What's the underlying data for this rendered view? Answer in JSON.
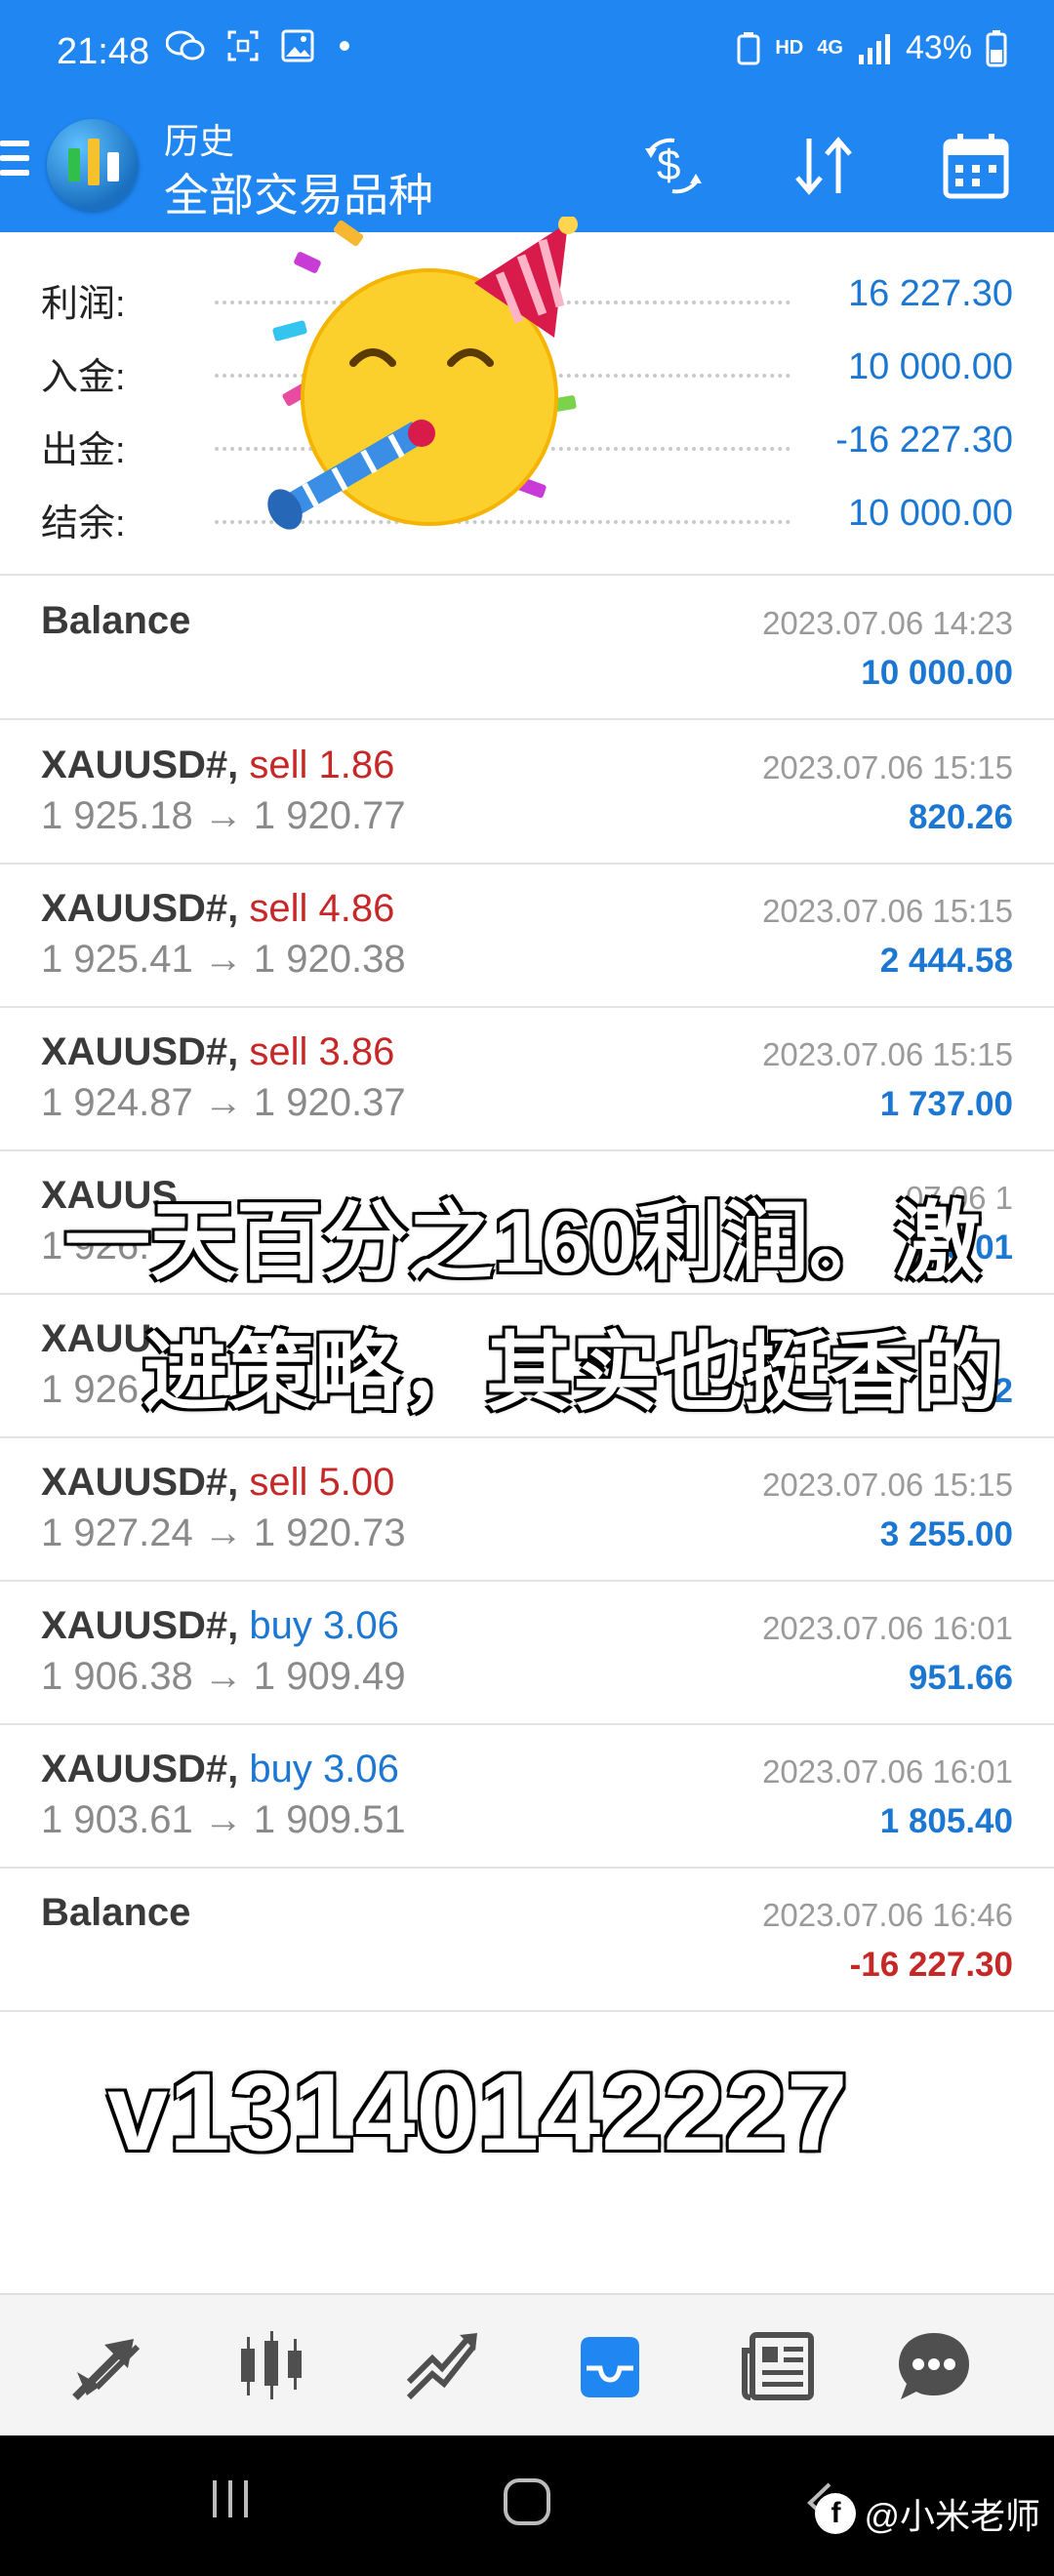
{
  "status_bar": {
    "time": "21:48",
    "network": "HD",
    "signal": "4G",
    "battery": "43%"
  },
  "app_bar": {
    "title": "历史",
    "subtitle": "全部交易品种"
  },
  "summary": [
    {
      "label": "利润:",
      "value": "16 227.30"
    },
    {
      "label": "入金:",
      "value": "10 000.00"
    },
    {
      "label": "出金:",
      "value": "-16 227.30"
    },
    {
      "label": "结余:",
      "value": "10 000.00"
    }
  ],
  "history": [
    {
      "type": "balance",
      "title": "Balance",
      "date": "2023.07.06 14:23",
      "profit": "10 000.00",
      "negative": false
    },
    {
      "type": "trade",
      "symbol": "XAUUSD#,",
      "direction": "sell",
      "volume": "sell 1.86",
      "prices": "1 925.18 → 1 920.77",
      "date": "2023.07.06 15:15",
      "profit": "820.26"
    },
    {
      "type": "trade",
      "symbol": "XAUUSD#,",
      "direction": "sell",
      "volume": "sell 4.86",
      "prices": "1 925.41 → 1 920.38",
      "date": "2023.07.06 15:15",
      "profit": "2 444.58"
    },
    {
      "type": "trade",
      "symbol": "XAUUSD#,",
      "direction": "sell",
      "volume": "sell 3.86",
      "prices": "1 924.87 → 1 920.37",
      "date": "2023.07.06 15:15",
      "profit": "1 737.00"
    },
    {
      "type": "trade",
      "symbol": "XAUUS",
      "direction": "sell",
      "volume": "",
      "prices": "1 926.",
      "date": "07.06 1",
      "profit": "3 01"
    },
    {
      "type": "trade",
      "symbol": "XAUU",
      "direction": "sell",
      "volume": "",
      "prices": "1 926.",
      "date": "",
      "profit": "2"
    },
    {
      "type": "trade",
      "symbol": "XAUUSD#,",
      "direction": "sell",
      "volume": "sell 5.00",
      "prices": "1 927.24 → 1 920.73",
      "date": "2023.07.06 15:15",
      "profit": "3 255.00"
    },
    {
      "type": "trade",
      "symbol": "XAUUSD#,",
      "direction": "buy",
      "volume": "buy 3.06",
      "prices": "1 906.38 → 1 909.49",
      "date": "2023.07.06 16:01",
      "profit": "951.66"
    },
    {
      "type": "trade",
      "symbol": "XAUUSD#,",
      "direction": "buy",
      "volume": "buy 3.06",
      "prices": "1 903.61 → 1 909.51",
      "date": "2023.07.06 16:01",
      "profit": "1 805.40"
    },
    {
      "type": "balance",
      "title": "Balance",
      "date": "2023.07.06 16:46",
      "profit": "-16 227.30",
      "negative": true
    }
  ],
  "overlay": {
    "caption_line1": "一天百分之160利润。激",
    "caption_line2": "进策略，其实也挺香的",
    "contact": "v13140142227"
  },
  "bottom_nav": [
    {
      "name": "quotes",
      "icon": "arrows-icon"
    },
    {
      "name": "chart",
      "icon": "candles-icon"
    },
    {
      "name": "trade",
      "icon": "trend-icon"
    },
    {
      "name": "history",
      "icon": "inbox-icon",
      "active": true
    },
    {
      "name": "news",
      "icon": "newspaper-icon"
    },
    {
      "name": "messages",
      "icon": "chat-icon"
    }
  ],
  "watermark": {
    "logo": "f",
    "text": "@小米老师"
  },
  "colors": {
    "primary": "#1f86f2",
    "profit_blue": "#1b77d2",
    "loss_red": "#c62828",
    "active_nav": "#1f86f2",
    "inactive_nav": "#4f4f4f"
  }
}
